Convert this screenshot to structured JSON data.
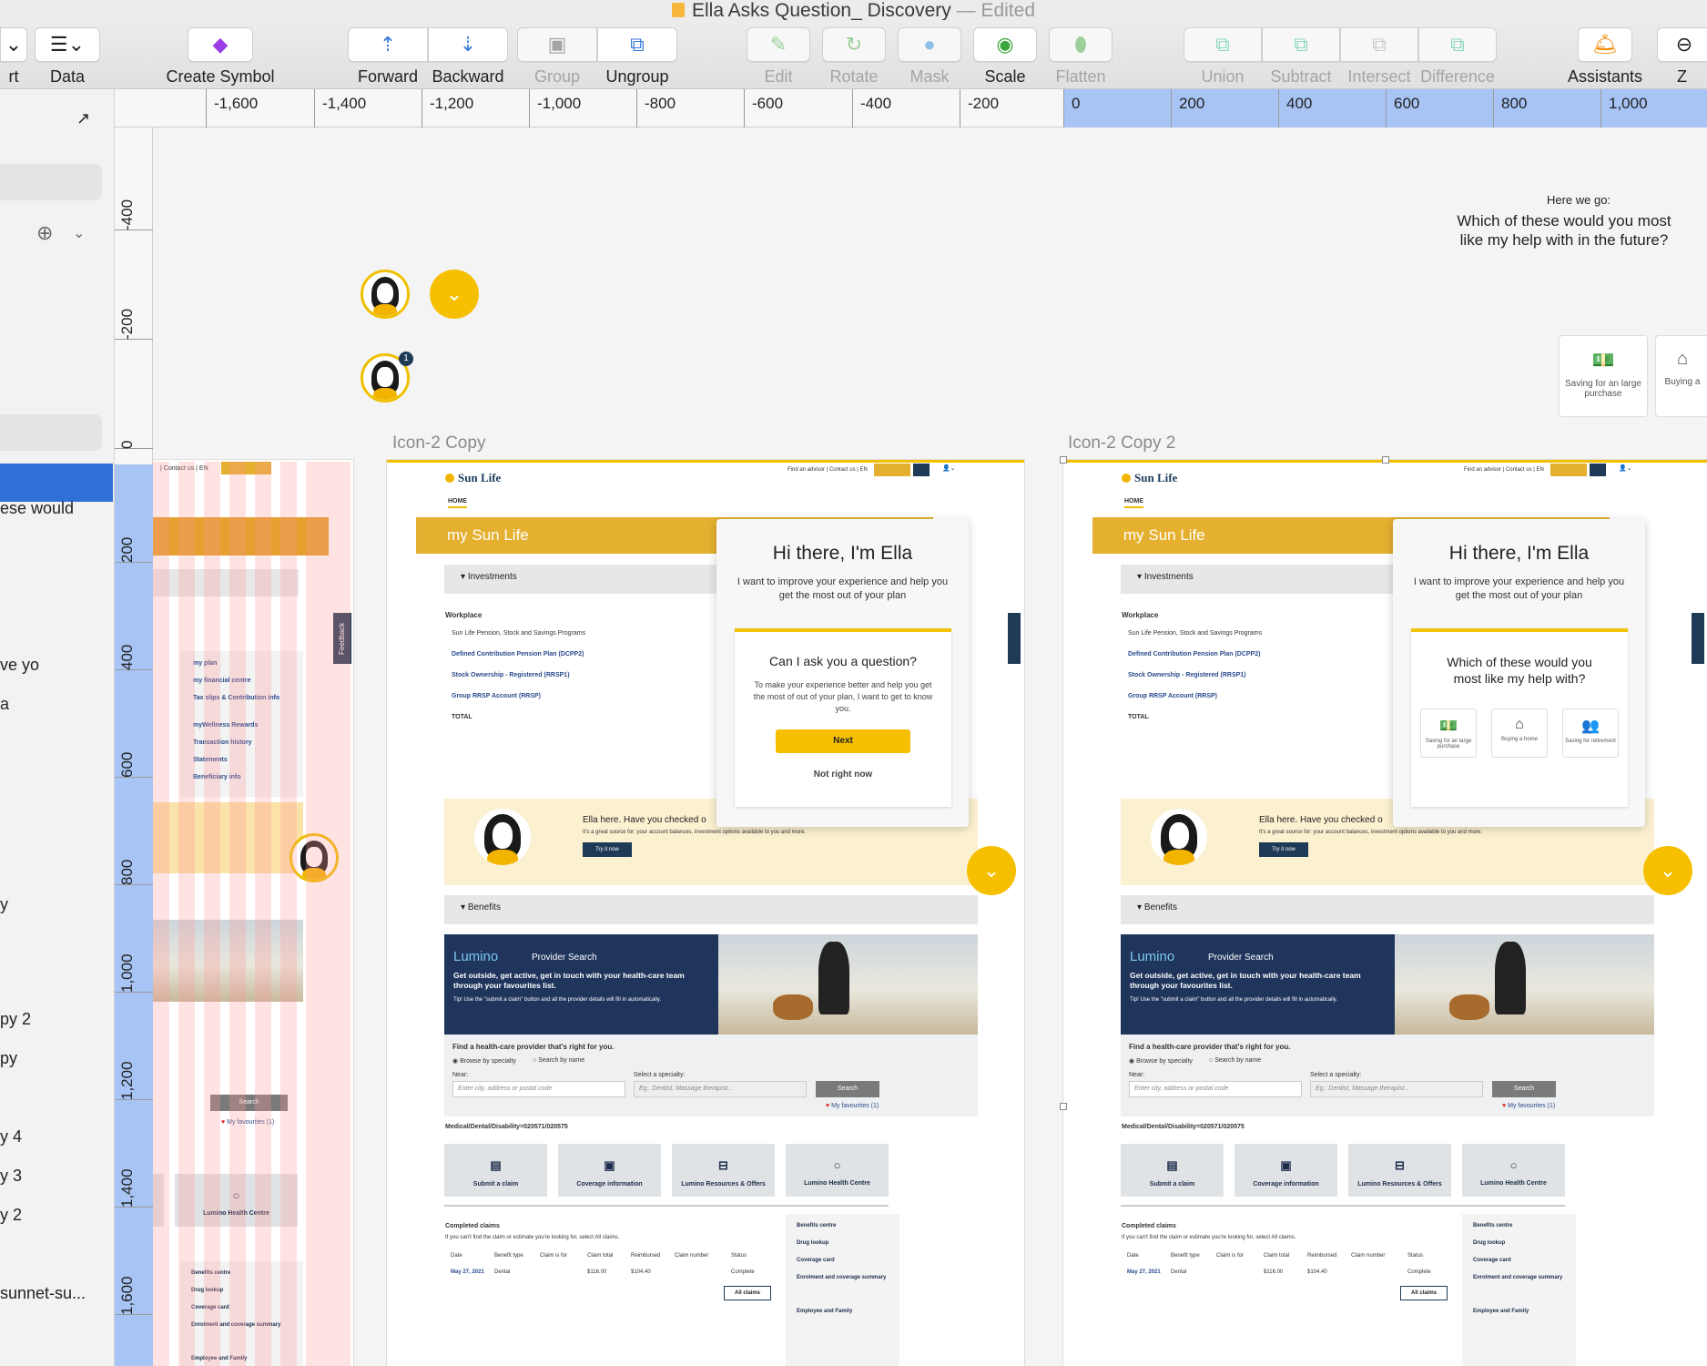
{
  "window": {
    "title": "Ella Asks Question_ Discovery",
    "status": "— Edited"
  },
  "toolbar": {
    "insert_partial": "rt",
    "data": "Data",
    "create_symbol": "Create Symbol",
    "forward": "Forward",
    "backward": "Backward",
    "group": "Group",
    "ungroup": "Ungroup",
    "edit": "Edit",
    "rotate": "Rotate",
    "mask": "Mask",
    "scale": "Scale",
    "flatten": "Flatten",
    "union": "Union",
    "subtract": "Subtract",
    "intersect": "Intersect",
    "difference": "Difference",
    "assistants": "Assistants",
    "zoom_partial": "Z"
  },
  "ruler_h": [
    "-1,600",
    "-1,400",
    "-1,200",
    "-1,000",
    "-800",
    "-600",
    "-400",
    "-200",
    "0",
    "200",
    "400",
    "600",
    "800",
    "1,000"
  ],
  "ruler_v_top": [
    "-400",
    "-200",
    "0"
  ],
  "ruler_v_bottom": [
    "200",
    "400",
    "600",
    "800",
    "1,000",
    "1,200",
    "1,400",
    "1,600"
  ],
  "sidebar": {
    "items": [
      "ese would",
      "ve yo",
      "a",
      "y",
      "py 2",
      "py",
      "y 4",
      "y 3",
      "y 2",
      "sunnet-su..."
    ]
  },
  "canvas": {
    "hint_small": "Here we go:",
    "hint_question": "Which of these would you most like my help with in the future?",
    "option1": "Saving for an large purchase",
    "option2": "Buying a",
    "badge": "1",
    "artboard1_label": "Icon-2 Copy",
    "artboard2_label": "Icon-2 Copy 2",
    "feedback": "Feedback"
  },
  "site": {
    "logo": "Sun Life",
    "top_links": "Find an advisor | Contact us | EN",
    "home": "HOME",
    "banner": "my Sun Life",
    "investments": "Investments",
    "workplace": "Workplace",
    "programs": "Sun Life Pension, Stock and Savings Programs",
    "plan1": "Defined Contribution Pension Plan (DCPP2)",
    "plan2": "Stock Ownership - Registered (RRSP1)",
    "plan3": "Group RRSP Account (RRSP)",
    "total": "TOTAL",
    "ella_strip": "Ella here. Have you checked o",
    "ella_strip_sub": "It's a great source for: your account balances, investment options available to you and more.",
    "try_now": "Try it now",
    "benefits": "Benefits",
    "lumino": "Lumino",
    "provider_search": "Provider Search",
    "lumino_text": "Get outside, get active, get in touch with your health-care team through your favourites list.",
    "lumino_tip": "Tip! Use the \"submit a claim\" button and all the provider details will fill in automatically.",
    "find_provider": "Find a health-care provider that's right for you.",
    "browse": "Browse by specialty",
    "search_name": "Search by name",
    "near": "Near:",
    "near_placeholder": "Enter city, address or postal code",
    "specialty": "Select a specialty:",
    "specialty_placeholder": "Eg.: Dentist, Massage therapist...",
    "search": "Search",
    "favourites": "My favourites (1)",
    "medical": "Medical/Dental/Disability=020571/020575",
    "tiles": [
      "Submit a claim",
      "Coverage information",
      "Lumino Resources & Offers",
      "Lumino Health Centre"
    ],
    "completed": "Completed claims",
    "completed_sub": "If you can't find the claim or estimate you're looking for, select All claims.",
    "claims_headers": [
      "Date",
      "Benefit type",
      "Claim is for",
      "Claim total",
      "Reimbursed",
      "Claim number",
      "Status"
    ],
    "claims_row": [
      "May 27, 2021",
      "Dental",
      "",
      "$116.00",
      "$104.40",
      "",
      "Complete"
    ],
    "all_claims": "All claims",
    "side_links": [
      "Benefits centre",
      "Drug lookup",
      "Coverage card",
      "Enrolment and coverage summary"
    ],
    "employee_family": "Employee and Family",
    "left_links": [
      "my plan",
      "my financial centre",
      "Tax slips & Contribution info",
      "myWellness Rewards",
      "Transaction history",
      "Statements",
      "Beneficiary info"
    ]
  },
  "dialog1": {
    "title": "Hi there, I'm Ella",
    "text": "I want to improve your experience and help you get the most out of your plan",
    "q_title": "Can I ask you a question?",
    "q_text": "To make your experience better and help you get the most of out of your plan, I want to get to know you.",
    "next": "Next",
    "not_now": "Not right now"
  },
  "dialog2": {
    "title": "Hi there, I'm Ella",
    "text": "I want to improve your experience and help you get the most out of your plan",
    "q_title": "Which of these would you most like my help with?",
    "options": [
      "Saving for an large purchase",
      "Buying a home",
      "Saving for retirement"
    ]
  },
  "colors": {
    "accent": "#f6c000",
    "banner": "#e5b030",
    "navy": "#1f355c",
    "ruler_highlight": "#a8c4f5"
  }
}
